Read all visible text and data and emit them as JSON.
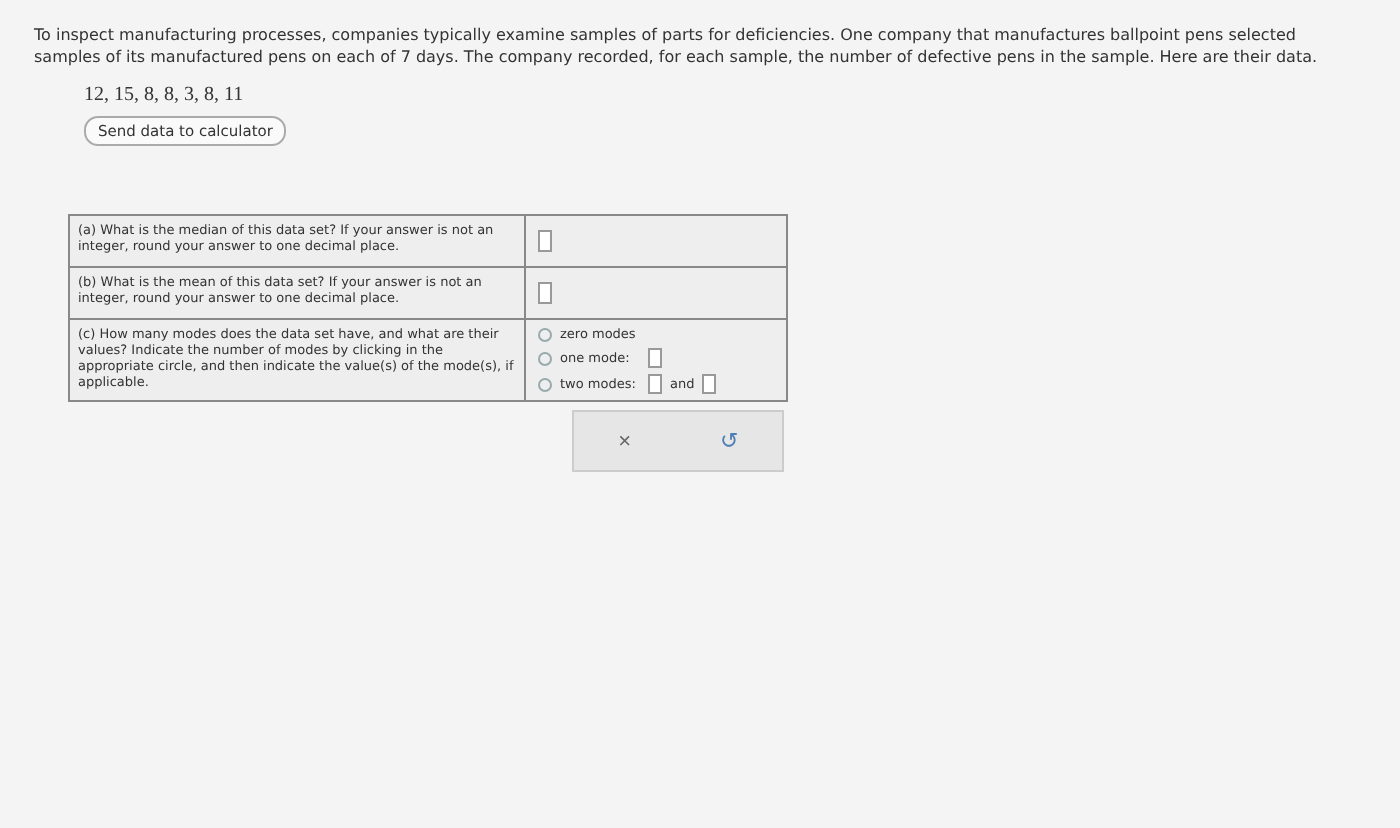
{
  "intro": "To inspect manufacturing processes, companies typically examine samples of parts for deficiencies. One company that manufactures ballpoint pens selected samples of its manufactured pens on each of 7 days. The company recorded, for each sample, the number of defective pens in the sample. Here are their data.",
  "data_values": "12, 15, 8, 8, 3, 8, 11",
  "calculator_button": "Send data to calculator",
  "questions": [
    {
      "kind": "input",
      "text": "(a) What is the median of this data set? If your answer is not an integer, round your answer to one decimal place."
    },
    {
      "kind": "input",
      "text": "(b) What is the mean of this data set? If your answer is not an integer, round your answer to one decimal place."
    },
    {
      "kind": "modes",
      "text": "(c) How many modes does the data set have, and what are their values? Indicate the number of modes by clicking in the appropriate circle, and then indicate the value(s) of the mode(s), if applicable.",
      "options": [
        {
          "kind": "none",
          "label": "zero modes",
          "selected": false
        },
        {
          "kind": "one",
          "label": "one mode:",
          "selected": false
        },
        {
          "kind": "two",
          "label": "two modes:",
          "joiner": "and",
          "selected": false
        }
      ]
    }
  ],
  "actions": [
    {
      "kind": "clear",
      "icon": "×"
    },
    {
      "kind": "undo",
      "icon": "↺"
    }
  ]
}
